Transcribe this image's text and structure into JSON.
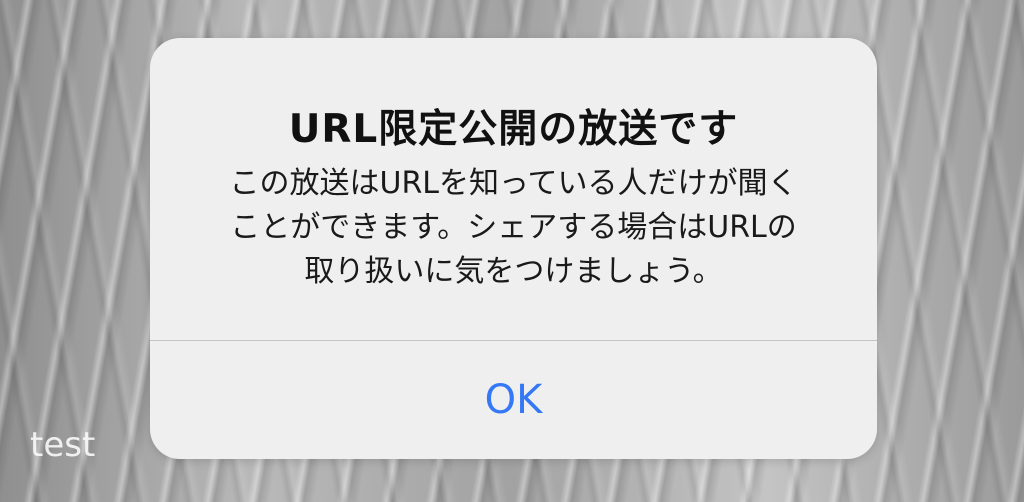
{
  "dialog": {
    "title": "URL限定公開の放送です",
    "message_lines": [
      "この放送はURLを知っている人だけが聞く",
      "ことができます。シェアする場合はURLの",
      "取り扱いに気をつけましょう。"
    ],
    "ok_label": "OK"
  },
  "watermark": "test",
  "colors": {
    "button": "#3478f6",
    "dialog_background": "#efefef"
  }
}
